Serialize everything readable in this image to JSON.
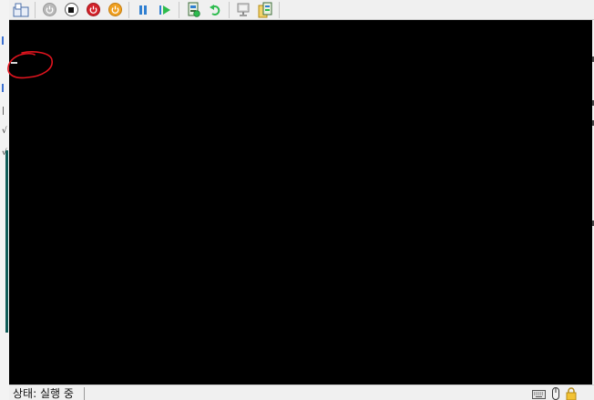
{
  "window": {
    "title": ""
  },
  "toolbar": {
    "buttons": [
      {
        "icon": "ctrl-alt-del-icon",
        "tooltip": ""
      },
      {
        "icon": "start-icon"
      },
      {
        "icon": "turn-off-icon"
      },
      {
        "icon": "shutdown-icon"
      },
      {
        "icon": "save-state-icon"
      },
      {
        "icon": "pause-icon"
      },
      {
        "icon": "resume-icon"
      },
      {
        "icon": "checkpoint-icon"
      },
      {
        "icon": "revert-icon"
      },
      {
        "icon": "enhanced-session-icon"
      },
      {
        "icon": "share-icon"
      }
    ]
  },
  "screen": {
    "background": "#000000",
    "cursor_char": "_"
  },
  "annotation": {
    "color": "#e0141e",
    "shape": "hand-drawn-circle"
  },
  "status": {
    "text": "상태: 실행 중"
  },
  "status_icons": [
    "keyboard-icon",
    "mouse-icon",
    "lock-icon"
  ],
  "colors": {
    "accent_blue": "#2f7fd1",
    "accent_green": "#2dbb4e",
    "red": "#d4222a",
    "orange": "#f0a020"
  }
}
